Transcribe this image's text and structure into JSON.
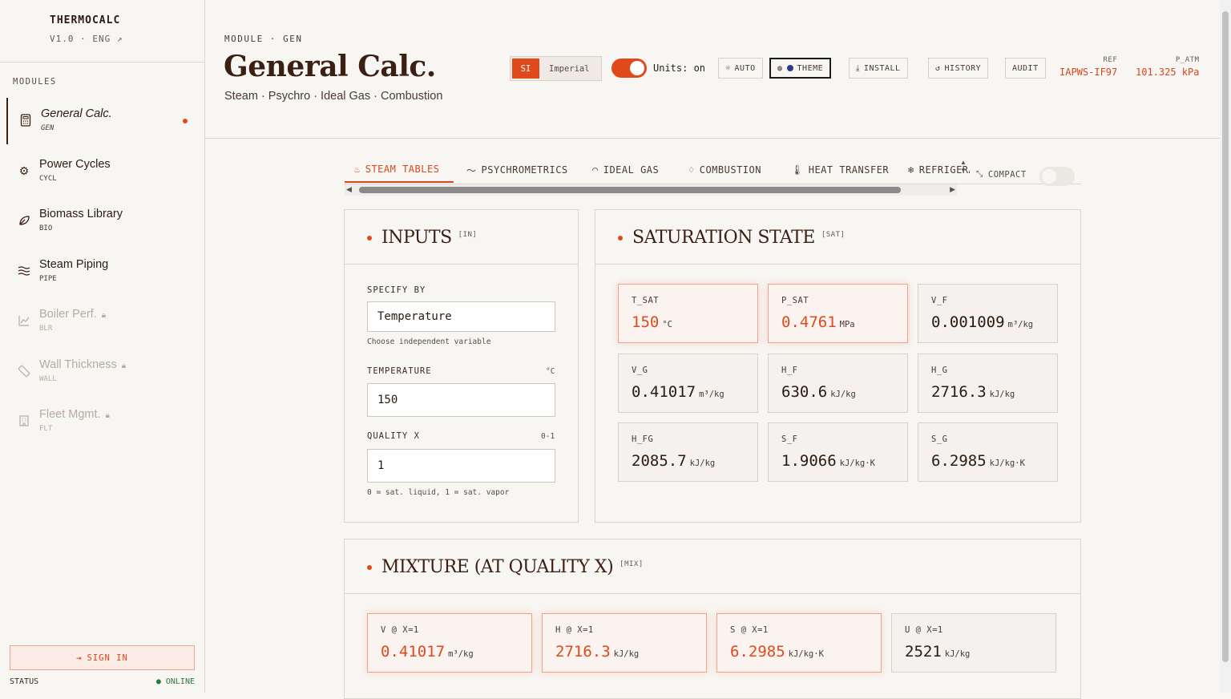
{
  "brand": {
    "name": "THERMOCALC",
    "version": "V1.0 · ENG ↗"
  },
  "sidebar": {
    "section_label": "MODULES",
    "items": [
      {
        "title": "General Calc.",
        "code": "GEN",
        "icon": "calculator-icon"
      },
      {
        "title": "Power Cycles",
        "code": "CYCL",
        "icon": "gear-icon"
      },
      {
        "title": "Biomass Library",
        "code": "BIO",
        "icon": "leaf-icon"
      },
      {
        "title": "Steam Piping",
        "code": "PIPE",
        "icon": "waves-icon"
      },
      {
        "title": "Boiler Perf.",
        "code": "BLR",
        "icon": "chart-icon"
      },
      {
        "title": "Wall Thickness",
        "code": "WALL",
        "icon": "ruler-icon"
      },
      {
        "title": "Fleet Mgmt.",
        "code": "FLT",
        "icon": "building-icon"
      }
    ],
    "signin_label": "SIGN IN",
    "status_label": "STATUS",
    "status_value": "● ONLINE"
  },
  "header": {
    "module_label": "MODULE · GEN",
    "title": "General Calc.",
    "subtitle": "Steam · Psychro · Ideal Gas · Combustion",
    "unit_si": "SI",
    "unit_imperial": "Imperial",
    "units_toggle_label": "Units: on",
    "buttons": {
      "auto": "AUTO",
      "theme": "THEME",
      "install": "INSTALL",
      "history": "HISTORY",
      "audit": "AUDIT"
    },
    "ref_label": "REF",
    "ref_value": "IAPWS-IF97",
    "patm_label": "P_ATM",
    "patm_value": "101.325 kPa"
  },
  "tabs": [
    {
      "label": "STEAM TABLES",
      "icon": "flame-icon"
    },
    {
      "label": "PSYCHROMETRICS",
      "icon": "pulse-icon"
    },
    {
      "label": "IDEAL GAS",
      "icon": "gauge-icon"
    },
    {
      "label": "COMBUSTION",
      "icon": "fire-icon"
    },
    {
      "label": "HEAT TRANSFER",
      "icon": "thermometer-icon"
    },
    {
      "label": "REFRIGERATION",
      "icon": "snowflake-icon"
    }
  ],
  "compact_label": "COMPACT",
  "inputs": {
    "title": "INPUTS",
    "tag": "[IN]",
    "specify_label": "SPECIFY BY",
    "specify_value": "Temperature",
    "specify_help": "Choose independent variable",
    "temperature_label": "TEMPERATURE",
    "temperature_unit": "°C",
    "temperature_value": "150",
    "quality_label": "QUALITY X",
    "quality_range": "0-1",
    "quality_value": "1",
    "quality_help": "0 = sat. liquid, 1 = sat. vapor"
  },
  "saturation": {
    "title": "SATURATION STATE",
    "tag": "[SAT]",
    "cells": [
      {
        "label": "T_SAT",
        "value": "150",
        "unit": "°C"
      },
      {
        "label": "P_SAT",
        "value": "0.4761",
        "unit": "MPa"
      },
      {
        "label": "V_F",
        "value": "0.001009",
        "unit": "m³/kg"
      },
      {
        "label": "V_G",
        "value": "0.41017",
        "unit": "m³/kg"
      },
      {
        "label": "H_F",
        "value": "630.6",
        "unit": "kJ/kg"
      },
      {
        "label": "H_G",
        "value": "2716.3",
        "unit": "kJ/kg"
      },
      {
        "label": "H_FG",
        "value": "2085.7",
        "unit": "kJ/kg"
      },
      {
        "label": "S_F",
        "value": "1.9066",
        "unit": "kJ/kg·K"
      },
      {
        "label": "S_G",
        "value": "6.2985",
        "unit": "kJ/kg·K"
      }
    ]
  },
  "mixture": {
    "title": "MIXTURE (AT QUALITY X)",
    "tag": "[MIX]",
    "cells": [
      {
        "label": "V @ X=1",
        "value": "0.41017",
        "unit": "m³/kg"
      },
      {
        "label": "H @ X=1",
        "value": "2716.3",
        "unit": "kJ/kg"
      },
      {
        "label": "S @ X=1",
        "value": "6.2985",
        "unit": "kJ/kg·K"
      },
      {
        "label": "U @ X=1",
        "value": "2521",
        "unit": "kJ/kg"
      }
    ]
  },
  "colors": {
    "accent": "#e04a1b",
    "text": "#3a1f12",
    "background": "#f8f6f3",
    "border": "#ddd6cf",
    "online": "#2f7a3a"
  }
}
